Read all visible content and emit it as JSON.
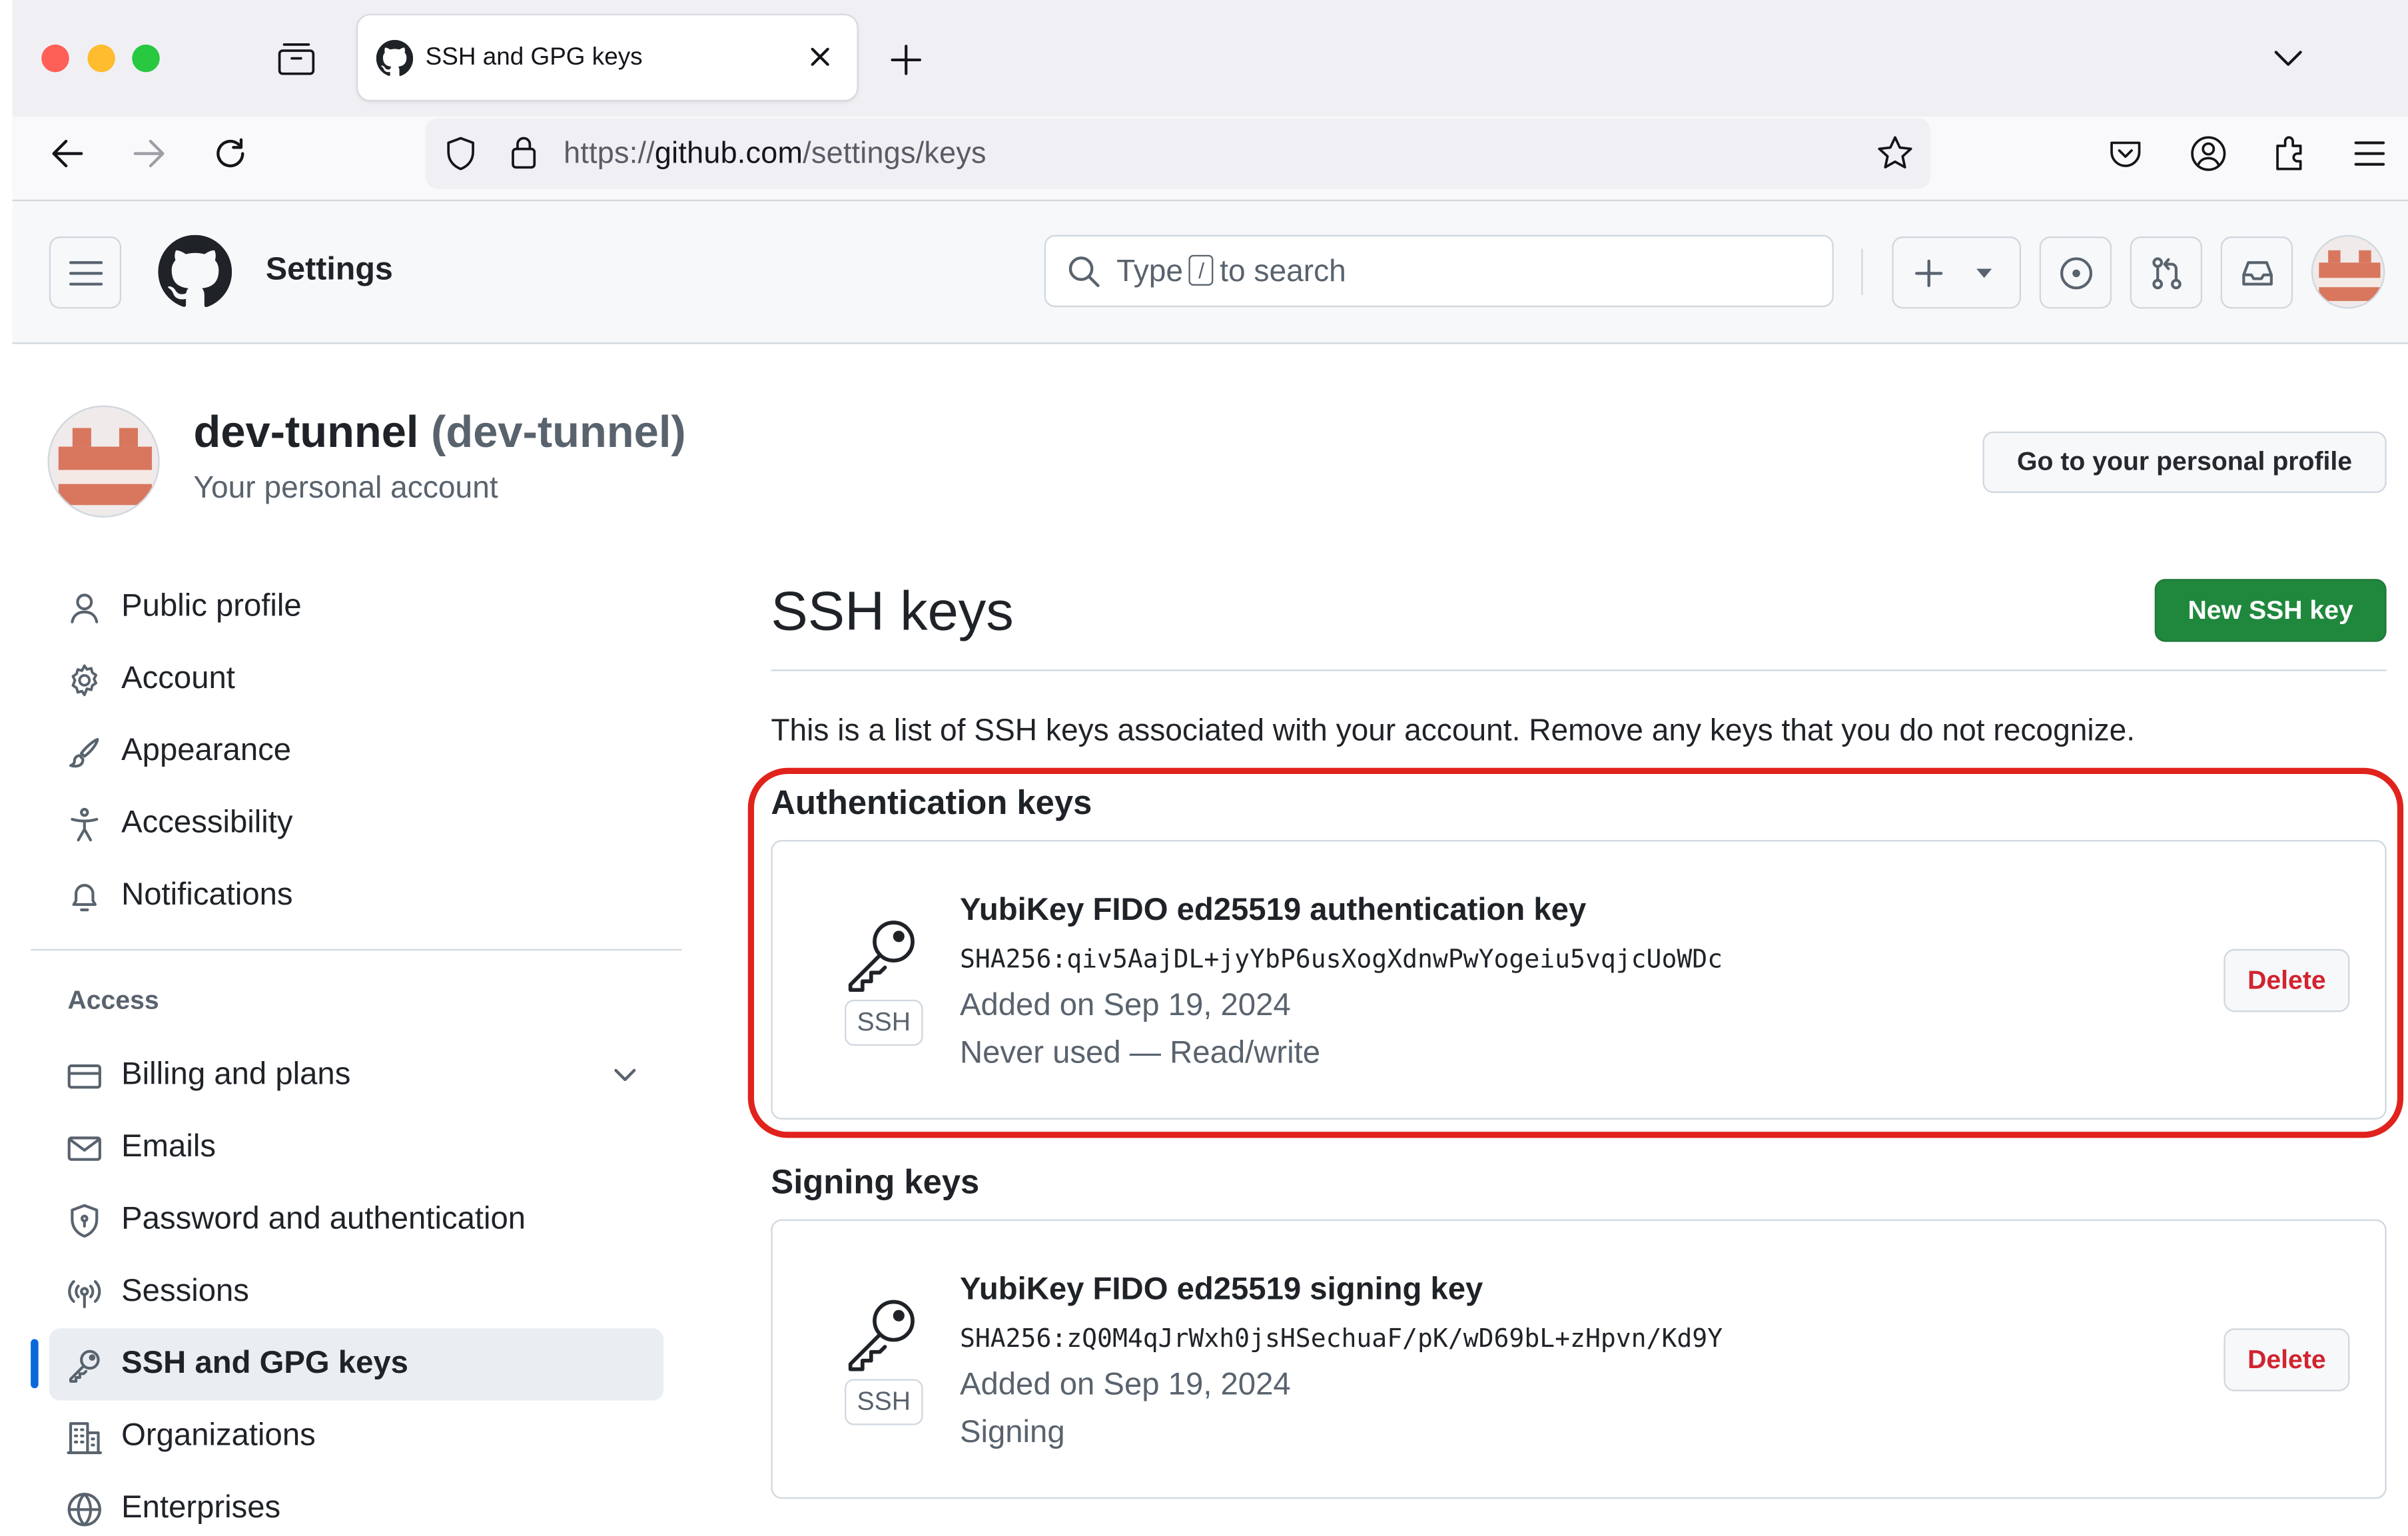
{
  "browser": {
    "tab_title": "SSH and GPG keys",
    "url_prefix": "https://",
    "url_host": "github.com",
    "url_path": "/settings/keys"
  },
  "header": {
    "page_title": "Settings",
    "search_before": "Type",
    "search_key": "/",
    "search_after": "to search"
  },
  "profile": {
    "name": "dev-tunnel",
    "handle": "(dev-tunnel)",
    "subtitle": "Your personal account",
    "go_profile_label": "Go to your personal profile"
  },
  "sidebar": {
    "items": [
      {
        "label": "Public profile",
        "icon": "person-icon"
      },
      {
        "label": "Account",
        "icon": "gear-icon"
      },
      {
        "label": "Appearance",
        "icon": "paintbrush-icon"
      },
      {
        "label": "Accessibility",
        "icon": "accessibility-icon"
      },
      {
        "label": "Notifications",
        "icon": "bell-icon"
      }
    ],
    "access_heading": "Access",
    "access_items": [
      {
        "label": "Billing and plans",
        "icon": "credit-card-icon"
      },
      {
        "label": "Emails",
        "icon": "mail-icon"
      },
      {
        "label": "Password and authentication",
        "icon": "shield-lock-icon"
      },
      {
        "label": "Sessions",
        "icon": "broadcast-icon"
      },
      {
        "label": "SSH and GPG keys",
        "icon": "key-icon",
        "active": true
      },
      {
        "label": "Organizations",
        "icon": "organization-icon"
      },
      {
        "label": "Enterprises",
        "icon": "globe-icon"
      }
    ]
  },
  "main": {
    "title": "SSH keys",
    "new_key_label": "New SSH key",
    "intro": "This is a list of SSH keys associated with your account. Remove any keys that you do not recognize.",
    "auth_heading": "Authentication keys",
    "auth_key": {
      "badge": "SSH",
      "title": "YubiKey FIDO ed25519 authentication key",
      "fingerprint": "SHA256:qiv5AajDL+jyYbP6usXogXdnwPwYogeiu5vqjcUoWDc",
      "added": "Added on Sep 19, 2024",
      "usage": "Never used — Read/write",
      "delete_label": "Delete"
    },
    "signing_heading": "Signing keys",
    "signing_key": {
      "badge": "SSH",
      "title": "YubiKey FIDO ed25519 signing key",
      "fingerprint": "SHA256:zQ0M4qJrWxh0jsHSechuaF/pK/wD69bL+zHpvn/Kd9Y",
      "added": "Added on Sep 19, 2024",
      "usage": "Signing",
      "delete_label": "Delete"
    }
  },
  "colors": {
    "primary_button": "#1f883d",
    "danger": "#d1242f",
    "highlight": "#e0231c",
    "active_marker": "#0969da"
  }
}
